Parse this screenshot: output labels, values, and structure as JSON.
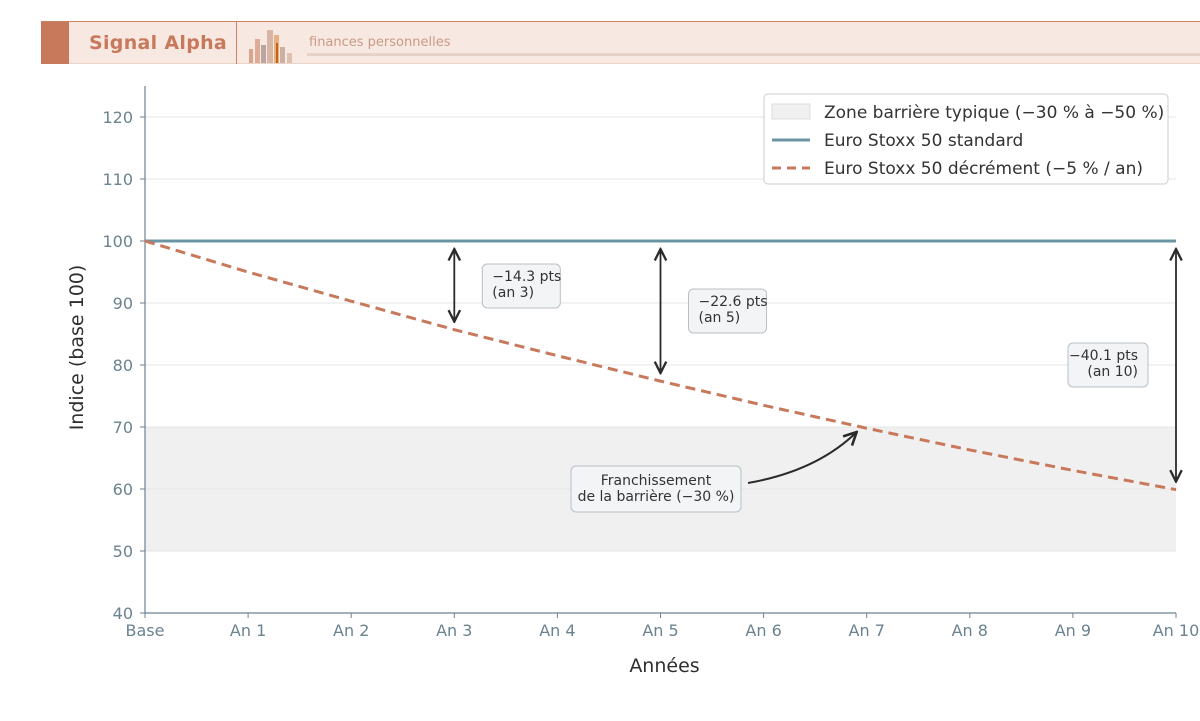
{
  "header": {
    "brand": "Signal Alpha",
    "tagline": "finances personnelles",
    "logo_icon": "city-skyline-icon"
  },
  "colors": {
    "standard": "#6b95a3",
    "decrement": "#c8785b",
    "zone": "#f0f0f0",
    "arrow": "#2b2b2b",
    "accent": "#c8785b"
  },
  "chart_data": {
    "type": "line",
    "x_labels": [
      "Base",
      "An 1",
      "An 2",
      "An 3",
      "An 4",
      "An 5",
      "An 6",
      "An 7",
      "An 8",
      "An 9",
      "An 10"
    ],
    "x": [
      0,
      1,
      2,
      3,
      4,
      5,
      6,
      7,
      8,
      9,
      10
    ],
    "xlabel": "Années",
    "ylabel": "Indice (base 100)",
    "ylim": [
      40,
      125
    ],
    "yticks": [
      40,
      50,
      60,
      70,
      80,
      90,
      100,
      110,
      120
    ],
    "grid": "horizontal",
    "legend_placement": "top-right",
    "zone": {
      "name": "Zone barrière typique (−30 % à −50 %)",
      "y_from": 50,
      "y_to": 70
    },
    "series": [
      {
        "name": "Euro Stoxx 50 standard",
        "style": "solid",
        "values": [
          100,
          100,
          100,
          100,
          100,
          100,
          100,
          100,
          100,
          100,
          100
        ]
      },
      {
        "name": "Euro Stoxx 50 décrément (−5 % / an)",
        "style": "dashed",
        "values": [
          100,
          95,
          90.3,
          85.7,
          81.5,
          77.4,
          73.5,
          69.8,
          66.3,
          63.0,
          59.9
        ]
      }
    ],
    "gap_annotations": [
      {
        "x": 3,
        "from": 100,
        "to": 85.7,
        "lines": [
          "−14.3 pts",
          "(an 3)"
        ],
        "align": "left"
      },
      {
        "x": 5,
        "from": 100,
        "to": 77.4,
        "lines": [
          "−22.6 pts",
          "(an 5)"
        ],
        "align": "left"
      },
      {
        "x": 10,
        "from": 100,
        "to": 59.9,
        "lines": [
          "−40.1 pts",
          "(an 10)"
        ],
        "align": "right"
      }
    ],
    "callout": {
      "lines": [
        "Franchissement",
        "de la barrière (−30 %)"
      ],
      "target_x": 7,
      "target_y": 70
    }
  }
}
